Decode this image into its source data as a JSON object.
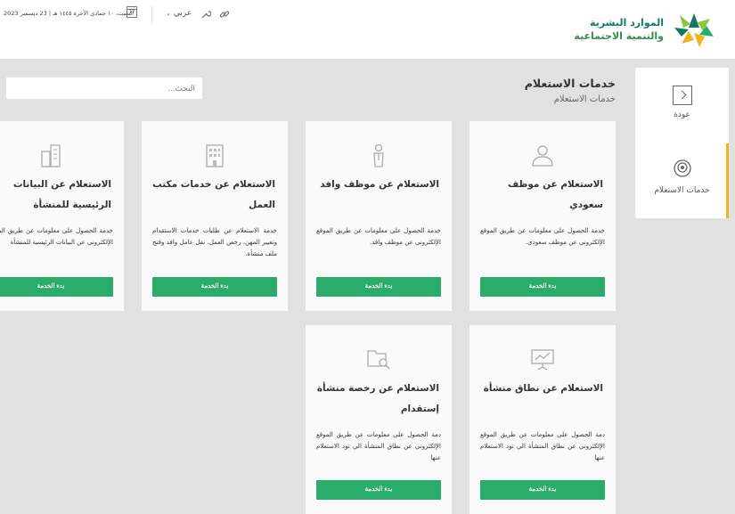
{
  "header": {
    "logo_line1": "الموارد البشرية",
    "logo_line2": "والتنمية الاجتماعية",
    "date": "السبت، ١٠ جمادى الآخرة ١٤٤٥ هـ | 23 ديسمبر 2023",
    "calendar_day": "17",
    "language": "عربي",
    "brand_colors": {
      "green": "#0f7a63",
      "light_green": "#8cc63f",
      "orange": "#f2b21e"
    }
  },
  "sidebar": {
    "back_label": "عودة",
    "inquiry_label": "خدمات الاستعلام"
  },
  "main": {
    "title": "خدمات الاستعلام",
    "breadcrumb": "خدمات الاستعلام",
    "search_placeholder": "البحث..."
  },
  "cards": [
    {
      "title": "الاستعلام عن موظف سعودي",
      "desc": "خدمة الحصول على معلومات عن طريق الموقع الإلكتروني عن موظف سعودي.",
      "button": "بدء الخدمة",
      "icon": "user-icon"
    },
    {
      "title": "الاستعلام عن موظف وافد",
      "desc": "خدمة الحصول على معلومات عن طريق الموقع الإلكتروني عن موظف وافد.",
      "button": "بدء الخدمة",
      "icon": "worker-icon"
    },
    {
      "title": "الاستعلام عن خدمات مكتب العمل",
      "desc": "خدمة الاستعلام عن طلبات خدمات الاستقدام وتغيير المهن، رخص العمل، نقل عامل وافد وفتح ملف منشأة.",
      "button": "بدء الخدمة",
      "icon": "building-icon"
    },
    {
      "title": "الاستعلام عن البيانات الرئيسية للمنشأة",
      "desc": "خدمة الحصول على معلومات عن طريق الموقع الإلكتروني عن البيانات الرئيسية للمنشأة",
      "button": "بدء الخدمة",
      "icon": "buildings-icon"
    },
    {
      "title": "الاستعلام عن نطاق منشأة",
      "desc": "دمة الحصول على معلومات عن طريق الموقع الإلكتروني عن نطاق المنشأة الي تود الاستعلام عنها",
      "button": "بدء الخدمة",
      "icon": "presentation-chart-icon"
    },
    {
      "title": "الاستعلام عن رخصة منشأة إستقدام",
      "desc": "دمة الحصول على معلومات عن طريق الموقع الإلكتروني عن نطاق المنشأة الي تود الاستعلام عنها",
      "button": "بدء الخدمة",
      "icon": "folder-search-icon"
    }
  ]
}
